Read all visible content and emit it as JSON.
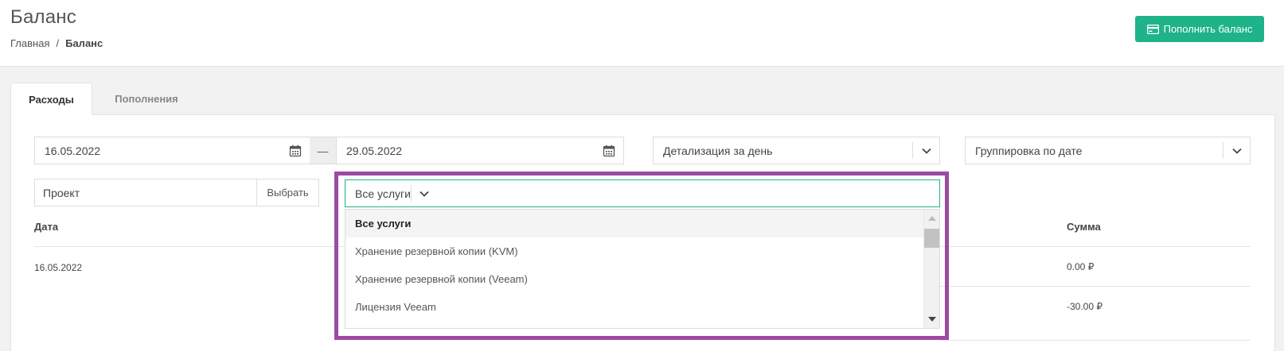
{
  "header": {
    "title": "Баланс",
    "breadcrumb": {
      "home": "Главная",
      "separator": "/",
      "current": "Баланс"
    },
    "topup_button": "Пополнить баланс"
  },
  "tabs": [
    {
      "label": "Расходы",
      "active": true
    },
    {
      "label": "Пополнения",
      "active": false
    }
  ],
  "filters": {
    "date_from": "16.05.2022",
    "date_separator": "—",
    "date_to": "29.05.2022",
    "detail_select": "Детализация за день",
    "group_select": "Группировка по дате",
    "project_placeholder": "Проект",
    "choose_button": "Выбрать",
    "services_select": "Все услуги"
  },
  "dropdown": {
    "options": [
      "Все услуги",
      "Хранение резервной копии (KVM)",
      "Хранение резервной копии (Veeam)",
      "Лицензия Veeam"
    ],
    "selected_index": 0
  },
  "table": {
    "columns": {
      "date": "Дата",
      "sum": "Сумма"
    },
    "rows": [
      {
        "date": "16.05.2022",
        "sum": "0.00 ₽"
      },
      {
        "date": "",
        "sum": "-30.00 ₽"
      }
    ]
  },
  "colors": {
    "accent": "#1fb38a",
    "highlight_frame": "#9c4aa3"
  }
}
